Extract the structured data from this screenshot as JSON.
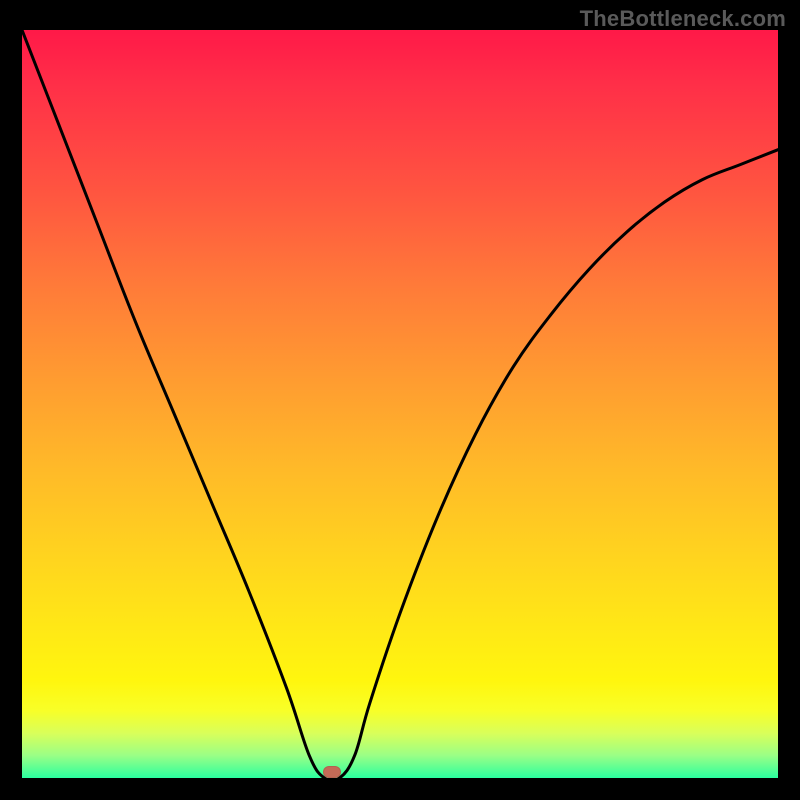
{
  "watermark": "TheBottleneck.com",
  "colors": {
    "curve": "#000000",
    "marker": "#c46a57",
    "frame": "#000000"
  },
  "chart_data": {
    "type": "line",
    "title": "",
    "xlabel": "",
    "ylabel": "",
    "xlim": [
      0,
      100
    ],
    "ylim": [
      0,
      100
    ],
    "grid": false,
    "legend": false,
    "note": "No numeric axis ticks or data labels are printed on the chart; values are visual estimates based on position within the plotting area (x and y run 0–100).",
    "series": [
      {
        "name": "bottleneck-curve",
        "x": [
          0,
          5,
          10,
          15,
          20,
          25,
          30,
          35,
          38,
          40,
          42,
          44,
          46,
          50,
          55,
          60,
          65,
          70,
          75,
          80,
          85,
          90,
          95,
          100
        ],
        "y": [
          100,
          87,
          74,
          61,
          49,
          37,
          25,
          12,
          3,
          0,
          0,
          3,
          10,
          22,
          35,
          46,
          55,
          62,
          68,
          73,
          77,
          80,
          82,
          84
        ]
      }
    ],
    "marker": {
      "x": 41,
      "y": 0.5
    },
    "background_gradient": {
      "direction": "vertical",
      "stops": [
        {
          "pos": 0.0,
          "color": "#ff1948"
        },
        {
          "pos": 0.5,
          "color": "#ff9a31"
        },
        {
          "pos": 0.85,
          "color": "#fff60e"
        },
        {
          "pos": 1.0,
          "color": "#2bff9f"
        }
      ]
    }
  }
}
